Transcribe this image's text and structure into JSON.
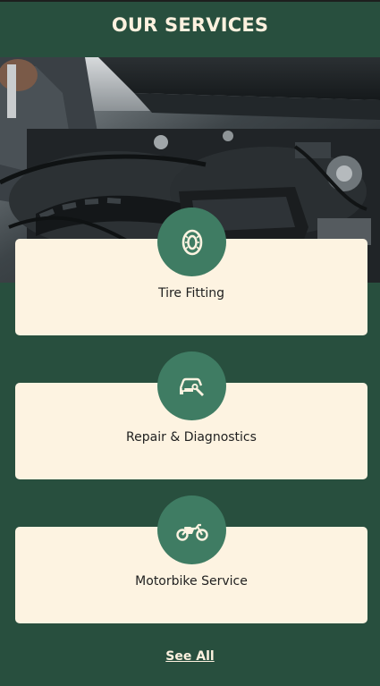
{
  "header": {
    "title": "OUR SERVICES"
  },
  "hero": {
    "image": "car-engine-bay-mechanic-photo"
  },
  "services": [
    {
      "label": "Tire Fitting",
      "icon": "tire-icon"
    },
    {
      "label": "Repair & Diagnostics",
      "icon": "car-wrench-icon"
    },
    {
      "label": "Motorbike Service",
      "icon": "motorbike-icon"
    }
  ],
  "footer": {
    "see_all_label": "See All"
  },
  "colors": {
    "background": "#284f3e",
    "card": "#fdf3e1",
    "badge": "#3f7c63",
    "title_text": "#fdf1df"
  }
}
